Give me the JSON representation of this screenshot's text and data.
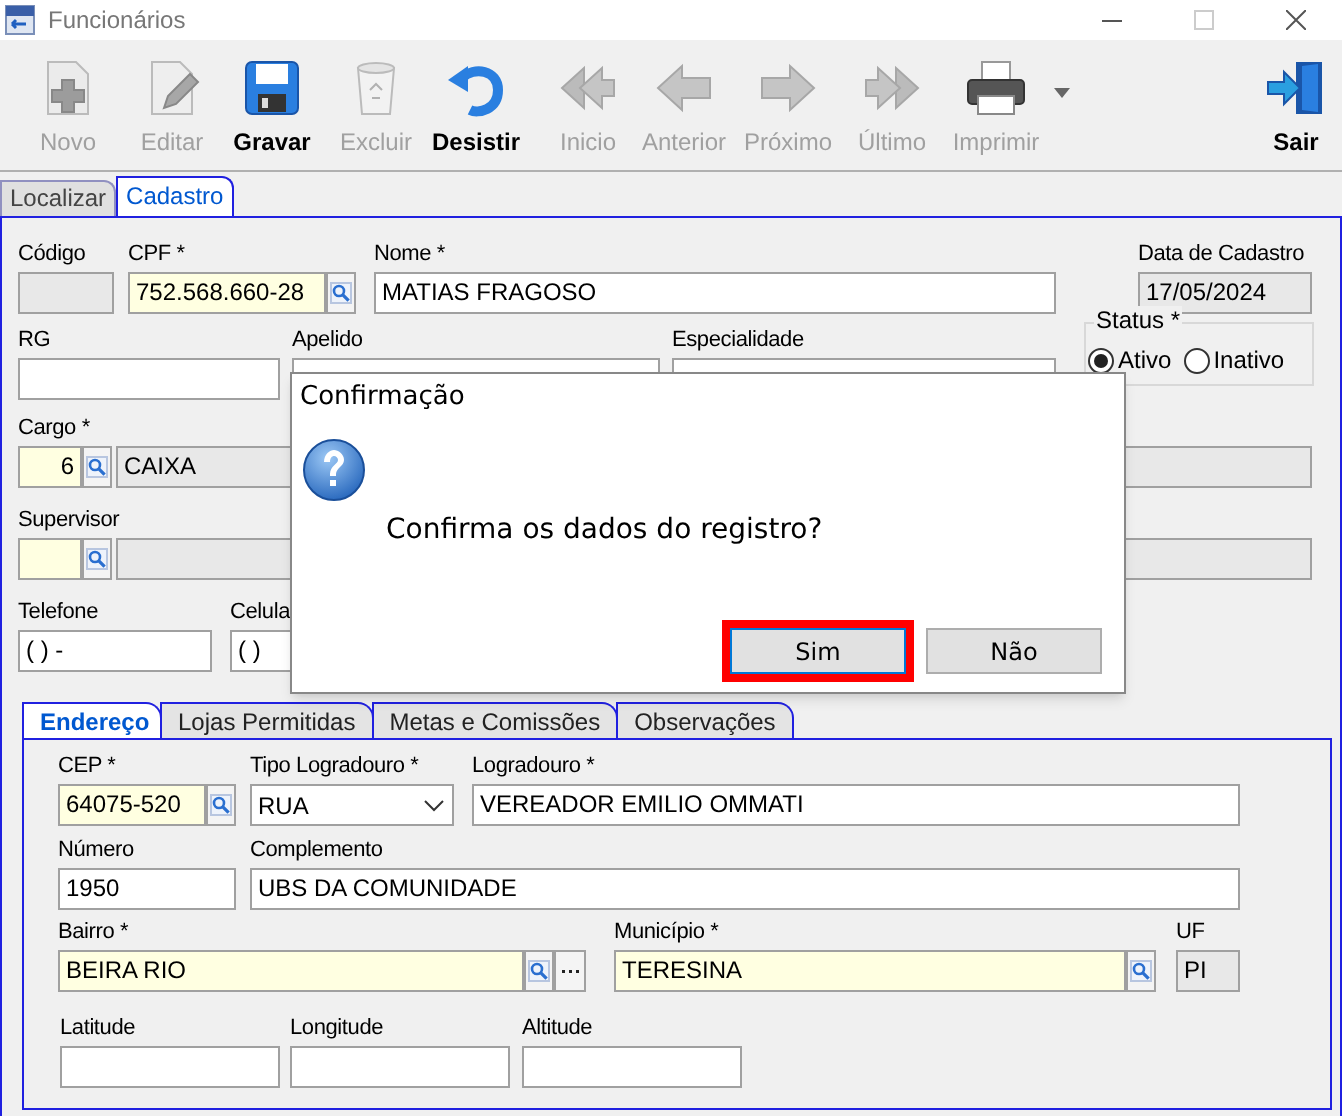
{
  "window": {
    "title": "Funcionários"
  },
  "toolbar": [
    {
      "label": "Novo",
      "kind": "new",
      "disabled": true
    },
    {
      "label": "Editar",
      "kind": "edit",
      "disabled": true
    },
    {
      "label": "Gravar",
      "kind": "save",
      "disabled": false
    },
    {
      "label": "Excluir",
      "kind": "delete",
      "disabled": true
    },
    {
      "label": "Desistir",
      "kind": "undo",
      "disabled": false
    },
    {
      "label": "Inicio",
      "kind": "first",
      "disabled": true
    },
    {
      "label": "Anterior",
      "kind": "prev",
      "disabled": true
    },
    {
      "label": "Próximo",
      "kind": "next",
      "disabled": true
    },
    {
      "label": "Último",
      "kind": "last",
      "disabled": true
    },
    {
      "label": "Imprimir",
      "kind": "print",
      "disabled": true
    },
    {
      "label": "Sair",
      "kind": "exit",
      "disabled": false
    }
  ],
  "main_tabs": [
    {
      "label": "Localizar",
      "selected": false
    },
    {
      "label": "Cadastro",
      "selected": true
    }
  ],
  "form_rows": [
    [
      {
        "label": "Código",
        "kind": "readonly"
      },
      {
        "label": "CPF *",
        "kind": "lookup",
        "value": "752.568.660-28"
      },
      {
        "label": "Nome *",
        "kind": "text",
        "value": "MATIAS FRAGOSO"
      },
      {
        "label": "Data de Cadastro",
        "kind": "readonly",
        "value": "17/05/2024"
      }
    ],
    [
      {
        "label": "RG",
        "kind": "text"
      },
      {
        "label": "Apelido",
        "kind": "text"
      },
      {
        "label": "Especialidade",
        "kind": "text"
      }
    ],
    [
      {
        "label": "Cargo *",
        "kind": "code_lookup",
        "value": "6",
        "description": "CAIXA"
      }
    ],
    [
      {
        "label": "Supervisor",
        "kind": "code_lookup"
      }
    ],
    [
      {
        "label": "Telefone",
        "kind": "text",
        "value": "( )    -"
      },
      {
        "label": "Celula",
        "kind": "text",
        "value": "( )"
      }
    ]
  ],
  "status": {
    "label": "Status *",
    "options": [
      {
        "label": "Ativo",
        "selected": true
      },
      {
        "label": "Inativo",
        "selected": false
      }
    ]
  },
  "dialog": {
    "title": "Confirmação",
    "message": "Confirma os dados do registro?",
    "buttons": [
      {
        "label": "Sim",
        "highlighted": true
      },
      {
        "label": "Não",
        "highlighted": false
      }
    ]
  },
  "address_tabs": [
    {
      "label": "Endereço",
      "selected": true
    },
    {
      "label": "Lojas Permitidas",
      "selected": false
    },
    {
      "label": "Metas e Comissões",
      "selected": false
    },
    {
      "label": "Observações",
      "selected": false
    }
  ],
  "address_rows": [
    [
      {
        "label": "CEP *",
        "kind": "lookup",
        "value": "64075-520"
      },
      {
        "label": "Tipo Logradouro *",
        "kind": "combo",
        "value": "RUA"
      },
      {
        "label": "Logradouro *",
        "kind": "text",
        "value": "VEREADOR EMILIO OMMATI"
      }
    ],
    [
      {
        "label": "Número",
        "kind": "text",
        "value": "1950"
      },
      {
        "label": "Complemento",
        "kind": "text",
        "value": "UBS DA COMUNIDADE"
      }
    ],
    [
      {
        "label": "Bairro *",
        "kind": "lookup_more",
        "value": "BEIRA RIO"
      },
      {
        "label": "Município *",
        "kind": "lookup",
        "value": "TERESINA"
      },
      {
        "label": "UF",
        "kind": "readonly",
        "value": "PI"
      }
    ],
    [
      {
        "label": "Latitude",
        "kind": "text"
      },
      {
        "label": "Longitude",
        "kind": "text"
      },
      {
        "label": "Altitude",
        "kind": "text"
      }
    ]
  ]
}
